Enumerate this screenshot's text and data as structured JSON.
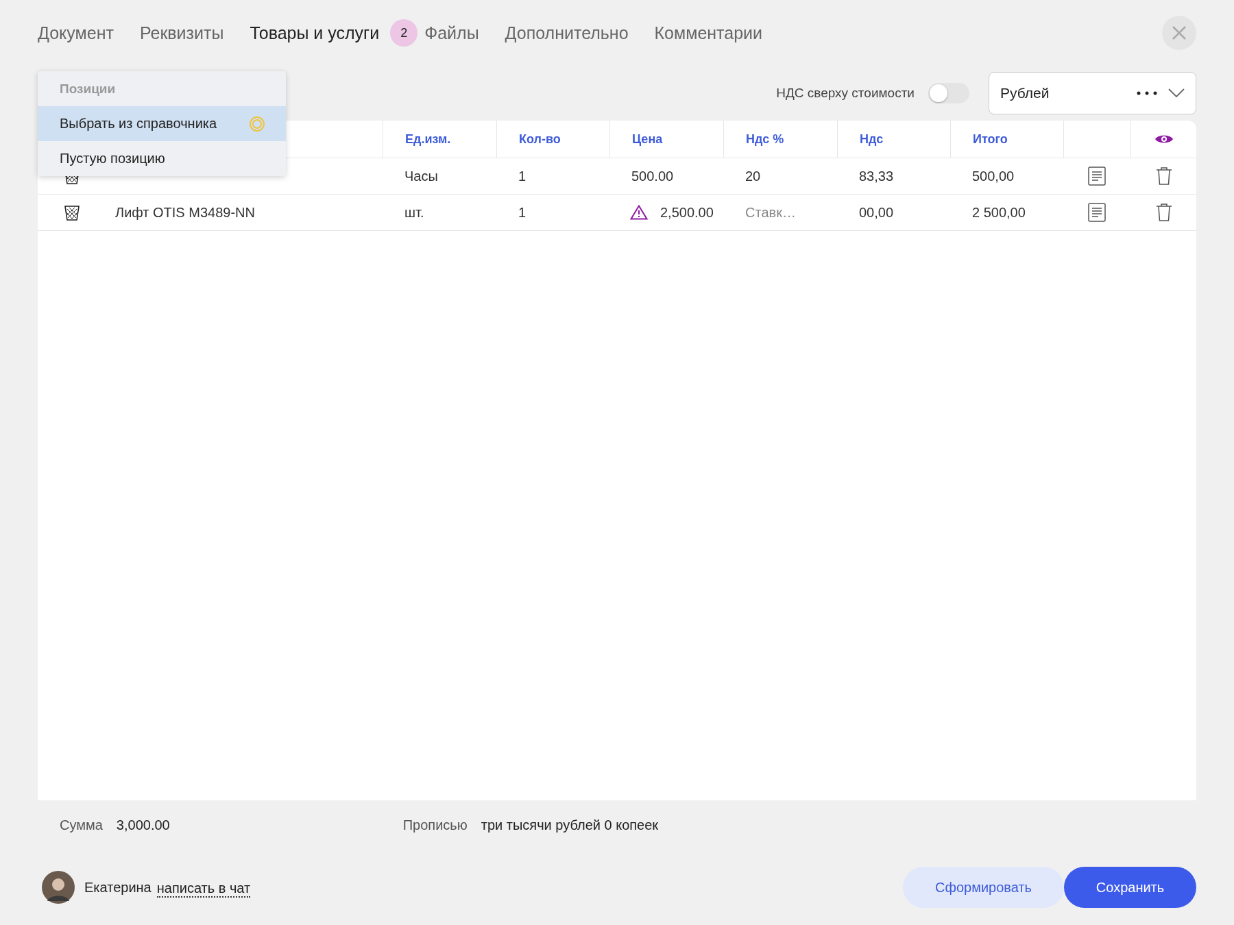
{
  "tabs": [
    {
      "label": "Документ",
      "selected": false
    },
    {
      "label": "Реквизиты",
      "selected": false
    },
    {
      "label": "Товары и услуги",
      "selected": true,
      "badge": "2"
    },
    {
      "label": "Файлы",
      "selected": false
    },
    {
      "label": "Дополнительно",
      "selected": false
    },
    {
      "label": "Комментарии",
      "selected": false
    }
  ],
  "vat_toggle": {
    "label": "НДС сверху стоимости",
    "on": false
  },
  "currency_select": {
    "value": "Рублей"
  },
  "add_menu": {
    "title": "Позиции",
    "items": [
      {
        "label": "Выбрать из справочника",
        "selected": true
      },
      {
        "label": "Пустую позицию",
        "selected": false
      }
    ]
  },
  "table": {
    "columns": [
      "Ед.изм.",
      "Кол-во",
      "Цена",
      "Ндс %",
      "Ндс",
      "Итого"
    ],
    "rows": [
      {
        "unit": "Часы",
        "qty": "1",
        "price": "500.00",
        "warning": false,
        "vat_rate": "20",
        "vat_rate_placeholder": false,
        "vat": "83,33",
        "total": "500,00"
      },
      {
        "name": "Лифт OTIS M3489-NN",
        "unit": "шт.",
        "qty": "1",
        "price": "2,500.00",
        "warning": true,
        "vat_rate": "Ставк…",
        "vat_rate_placeholder": true,
        "vat": "00,00",
        "total": "2 500,00"
      }
    ]
  },
  "summary": {
    "sum_label": "Сумма",
    "sum": "3,000.00",
    "words_label": "Прописью",
    "words": "три тысячи рублей 0 копеек"
  },
  "footer": {
    "user": "Екатерина",
    "chat_link": "написать в чат",
    "buttons": [
      {
        "label": "Сформировать",
        "kind": "secondary"
      },
      {
        "label": "Сохранить",
        "kind": "primary"
      }
    ]
  }
}
